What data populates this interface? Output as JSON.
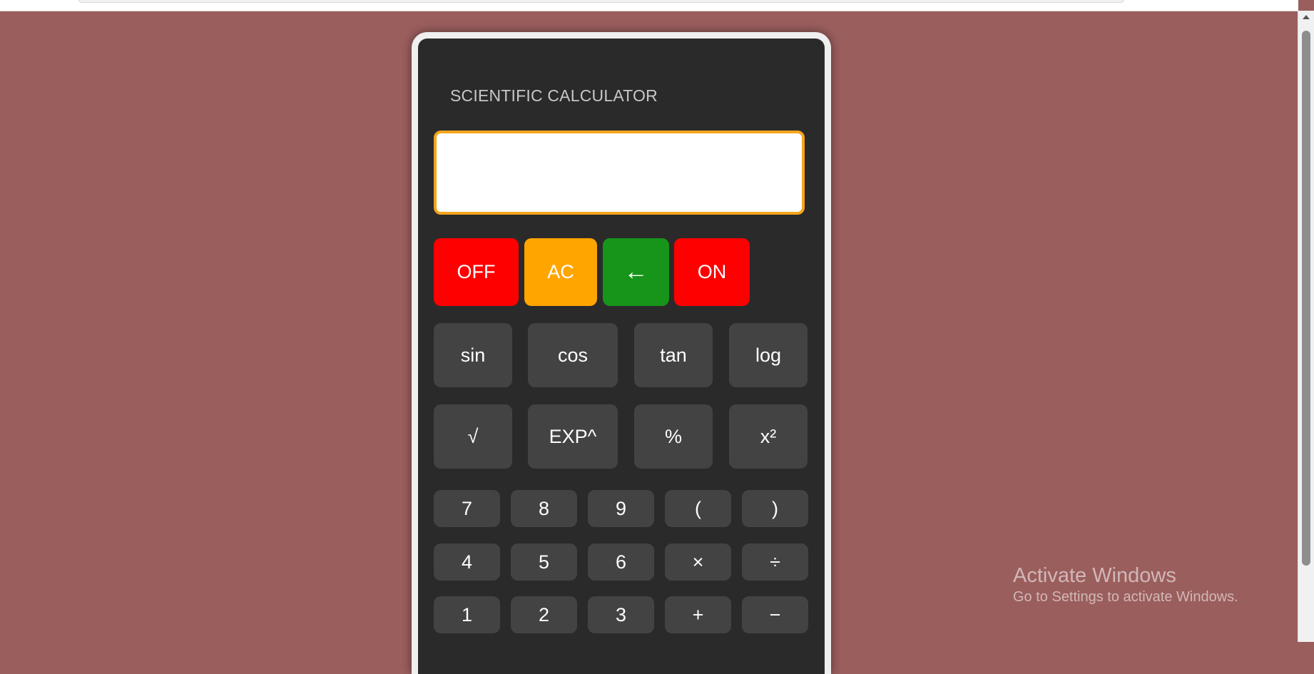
{
  "calculator": {
    "title": "SCIENTIFIC CALCULATOR",
    "display_value": "",
    "controls": [
      {
        "label": "OFF",
        "color": "#ff0000"
      },
      {
        "label": "AC",
        "color": "#ffa500"
      },
      {
        "label": "←",
        "color": "#17951a"
      },
      {
        "label": "ON",
        "color": "#ff0000"
      }
    ],
    "functions_row1": [
      "sin",
      "cos",
      "tan",
      "log"
    ],
    "functions_row2": [
      "√",
      "EXP^",
      "%",
      "x²"
    ],
    "keypad": [
      [
        "7",
        "8",
        "9",
        "(",
        ")"
      ],
      [
        "4",
        "5",
        "6",
        "×",
        "÷"
      ],
      [
        "1",
        "2",
        "3",
        "+",
        "−"
      ]
    ]
  },
  "windows_watermark": {
    "title": "Activate Windows",
    "subtitle": "Go to Settings to activate Windows."
  },
  "colors": {
    "page_background": "#9a5e5d",
    "calculator_body": "#2b2a2a",
    "display_border": "#f4a51c",
    "key_background": "#434343"
  }
}
